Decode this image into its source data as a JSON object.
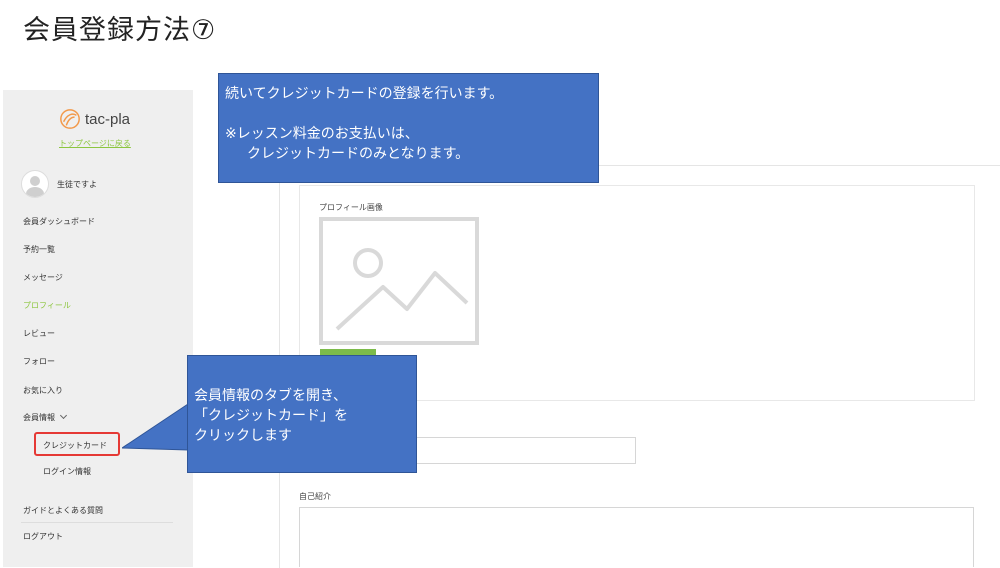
{
  "slide": {
    "title": "会員登録方法⑦"
  },
  "sidebar": {
    "logo_text": "tac-pla",
    "back_link": "トップページに戻る",
    "username": "生徒ですよ",
    "items": [
      {
        "label": "会員ダッシュボード"
      },
      {
        "label": "予約一覧"
      },
      {
        "label": "メッセージ"
      },
      {
        "label": "プロフィール"
      },
      {
        "label": "レビュー"
      },
      {
        "label": "フォロー"
      },
      {
        "label": "お気に入り"
      },
      {
        "label": "会員情報"
      }
    ],
    "sub_items": [
      {
        "label": "クレジットカード"
      },
      {
        "label": "ログイン情報"
      }
    ],
    "footer_items": [
      {
        "label": "ガイドとよくある質問"
      },
      {
        "label": "ログアウト"
      }
    ]
  },
  "main": {
    "profile_image_label": "プロフィール画像",
    "intro_label": "自己紹介"
  },
  "callouts": {
    "top": {
      "line1": "続いてクレジットカードの登録を行います。",
      "line2": "※レッスン料金のお支払いは、",
      "line3": "クレジットカードのみとなります。"
    },
    "mid": {
      "line1": "会員情報のタブを開き、",
      "line2": "「クレジットカード」を",
      "line3": "クリックします"
    }
  },
  "colors": {
    "accent_green": "#8cc63f",
    "callout_blue": "#4472c4",
    "highlight_red": "#e53935"
  },
  "icons": {
    "logo": "tac-pla-logo-icon",
    "avatar": "user-avatar-icon",
    "placeholder": "image-placeholder-icon",
    "chevron": "chevron-down-icon"
  }
}
